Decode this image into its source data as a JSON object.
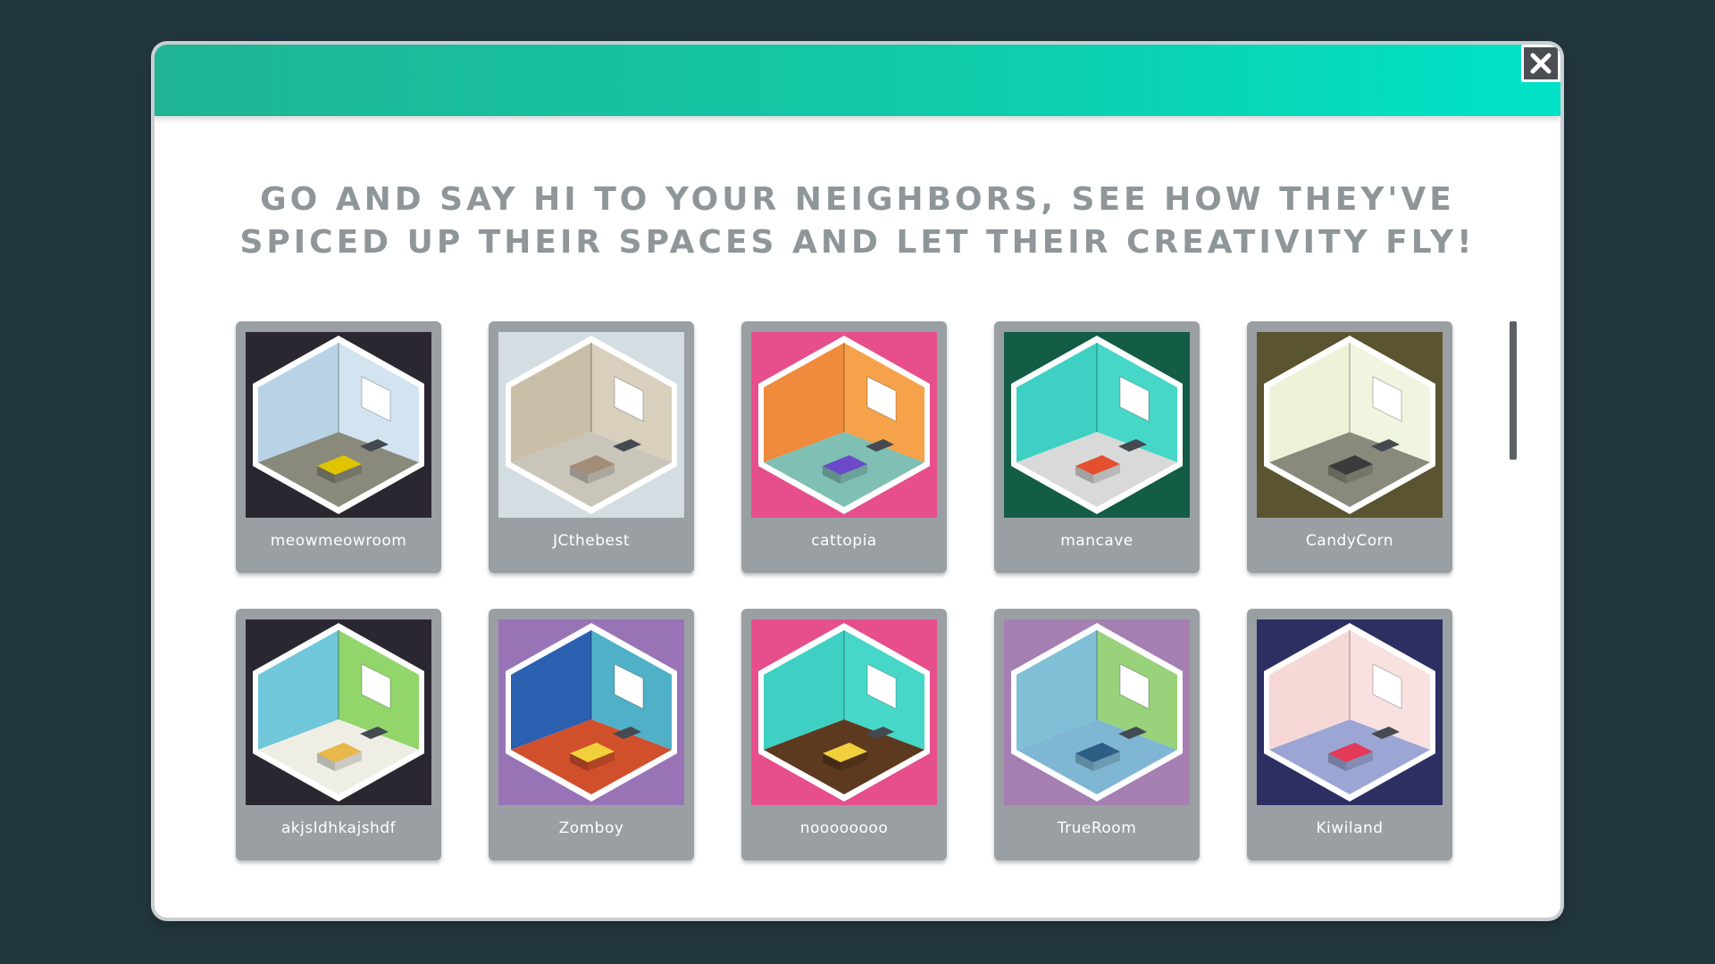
{
  "dialog": {
    "headline_line1": "GO AND SAY HI TO YOUR NEIGHBORS, SEE HOW THEY'VE",
    "headline_line2": "SPICED UP THEIR SPACES AND LET THEIR CREATIVITY FLY!",
    "close_icon": "close-x-icon",
    "header_colors": [
      "#1fb493",
      "#00e2c7"
    ]
  },
  "rooms": [
    {
      "name": "meowmeowroom",
      "bg": "#2b2730",
      "wall_left": "#b9d3e6",
      "wall_right": "#d2e4f0",
      "floor": "#8a8a7c",
      "accent": "#e0c400"
    },
    {
      "name": "JCthebest",
      "bg": "#d4dde2",
      "wall_left": "#c9bea7",
      "wall_right": "#d8cfbd",
      "floor": "#c9c5b8",
      "accent": "#a38d78"
    },
    {
      "name": "cattopia",
      "bg": "#e64f8b",
      "wall_left": "#f08a3c",
      "wall_right": "#f5a24a",
      "floor": "#7fbfb4",
      "accent": "#6b49c9"
    },
    {
      "name": "mancave",
      "bg": "#135c46",
      "wall_left": "#3ed1c3",
      "wall_right": "#46d7c8",
      "floor": "#d9d9d9",
      "accent": "#e34f2f"
    },
    {
      "name": "CandyCorn",
      "bg": "#5a5430",
      "wall_left": "#eef2d9",
      "wall_right": "#f1f4de",
      "floor": "#8a8a7c",
      "accent": "#3b3b3b"
    },
    {
      "name": "akjsldhkajshdf",
      "bg": "#2b2730",
      "wall_left": "#6fc7d9",
      "wall_right": "#92d66b",
      "floor": "#efeee5",
      "accent": "#e9b84a"
    },
    {
      "name": "Zomboy",
      "bg": "#9874b6",
      "wall_left": "#2b5fb0",
      "wall_right": "#4fb0c8",
      "floor": "#d1502c",
      "accent": "#f2d03b"
    },
    {
      "name": "noooooooo",
      "bg": "#e64f8b",
      "wall_left": "#3ed1c3",
      "wall_right": "#46d7c8",
      "floor": "#5d3a1f",
      "accent": "#f2d03b"
    },
    {
      "name": "TrueRoom",
      "bg": "#a57fb2",
      "wall_left": "#7fc0d6",
      "wall_right": "#98d27a",
      "floor": "#7fb6d3",
      "accent": "#2d5e86"
    },
    {
      "name": "Kiwiland",
      "bg": "#2d2f63",
      "wall_left": "#f6d9d7",
      "wall_right": "#f8e1df",
      "floor": "#9ba6d4",
      "accent": "#e33a5a"
    }
  ]
}
